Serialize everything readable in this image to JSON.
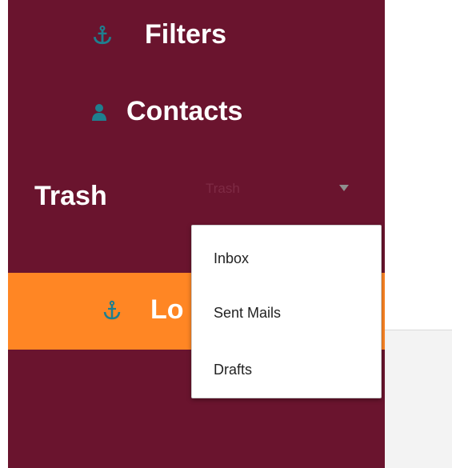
{
  "colors": {
    "sidebar_bg": "#6a142e",
    "logout_bg": "#ff8624",
    "icon_teal": "#1f7f8f",
    "text_white": "#ffffff"
  },
  "nav": {
    "filters": {
      "icon": "anchor-icon",
      "label": "Filters"
    },
    "contacts": {
      "icon": "user-icon",
      "label": "Contacts"
    },
    "logout": {
      "icon": "anchor-icon",
      "label": "Lo"
    }
  },
  "trash": {
    "label": "Trash",
    "select": {
      "value": "Trash",
      "options": [
        "Inbox",
        "Sent Mails",
        "Drafts"
      ]
    }
  }
}
